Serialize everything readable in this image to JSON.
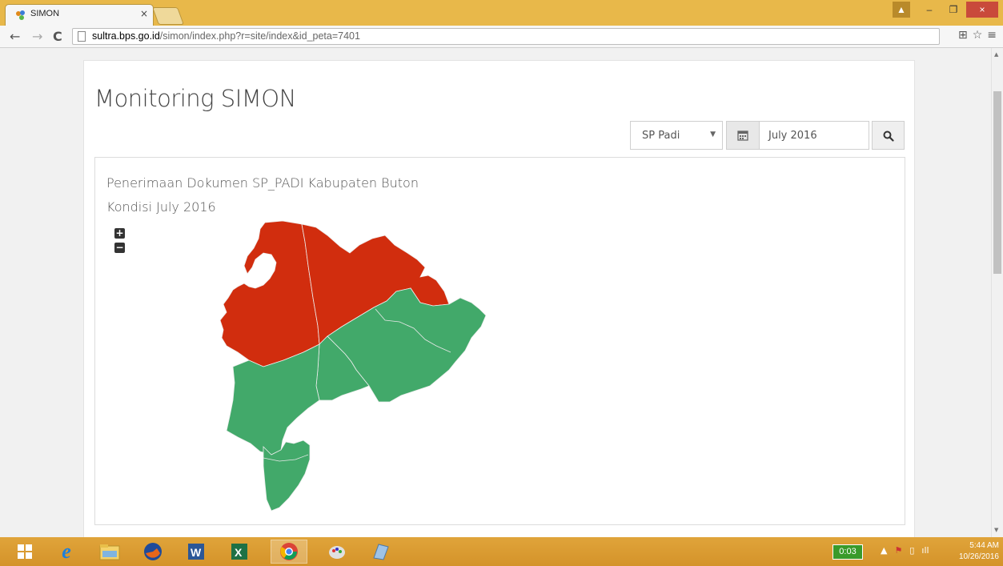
{
  "browser": {
    "tab_title": "SIMON",
    "tab_close": "×",
    "url_host": "sultra.bps.go.id",
    "url_path": "/simon/index.php?r=site/index&id_peta=7401",
    "window_buttons": {
      "user": "▲",
      "minimize": "–",
      "restore": "❐",
      "close": "×"
    }
  },
  "page": {
    "title": "Monitoring SIMON",
    "filter": {
      "survey_selected": "SP Padi",
      "period_value": "July 2016"
    }
  },
  "map": {
    "title": "Penerimaan Dokumen SP_PADI Kabupaten Buton",
    "subtitle": "Kondisi July 2016",
    "zoom_in": "+",
    "zoom_out": "−",
    "colors": {
      "received": "#42a96a",
      "not_received": "#d12d0e"
    }
  },
  "taskbar": {
    "apps": [
      "start",
      "internet-explorer",
      "file-explorer",
      "firefox",
      "word",
      "excel",
      "chrome",
      "paint",
      "notes"
    ],
    "timer": "0:03",
    "clock_time": "5:44 AM",
    "clock_date": "10/26/2016"
  }
}
